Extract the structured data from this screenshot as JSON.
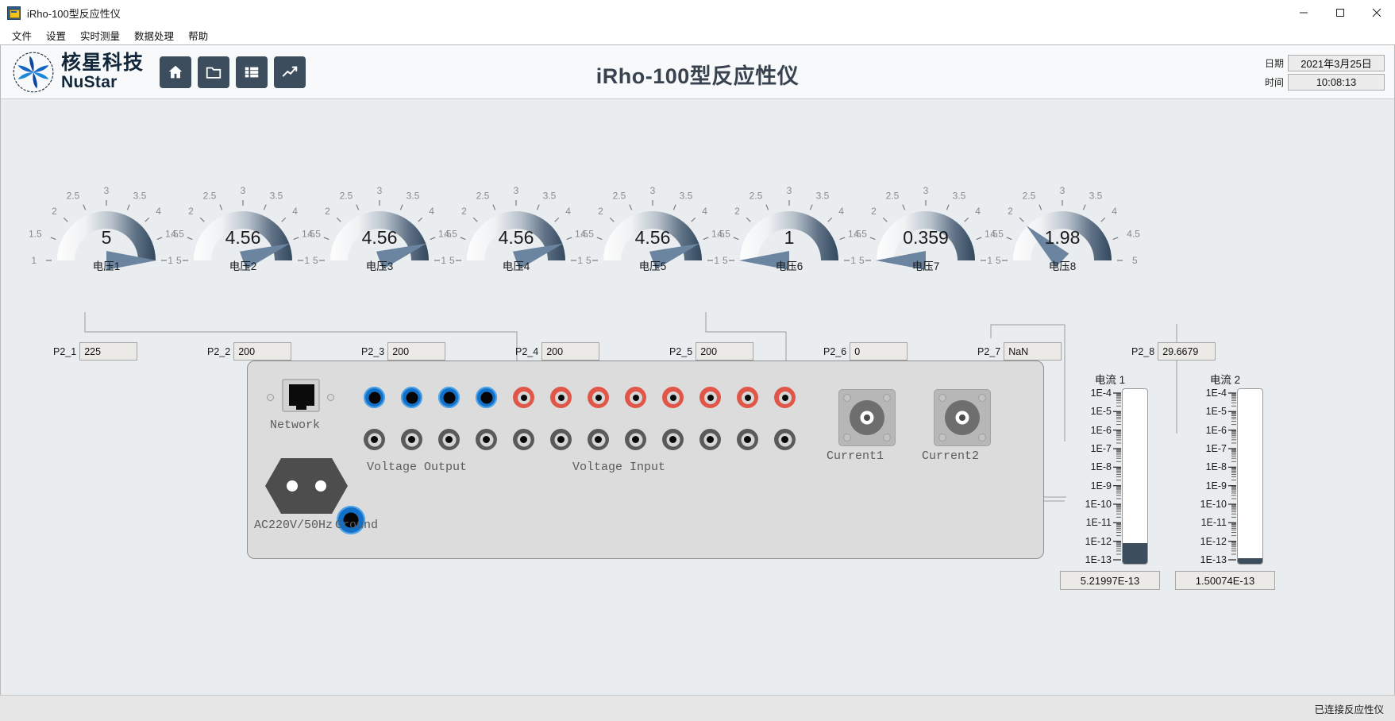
{
  "window": {
    "title": "iRho-100型反应性仪",
    "icon": "app-icon",
    "controls": {
      "minimize": "—",
      "maximize": "□",
      "close": "✕"
    }
  },
  "menubar": {
    "items": [
      {
        "label": "文件"
      },
      {
        "label": "设置"
      },
      {
        "label": "实时测量"
      },
      {
        "label": "数据处理"
      },
      {
        "label": "帮助"
      }
    ]
  },
  "header": {
    "logo": {
      "cn": "核星科技",
      "en": "NuStar",
      "icon": "nustar-logo-icon"
    },
    "title": "iRho-100型反应性仪",
    "toolbar": [
      {
        "name": "home",
        "icon": "home-icon"
      },
      {
        "name": "open-folder",
        "icon": "folder-icon"
      },
      {
        "name": "data-table",
        "icon": "list-icon"
      },
      {
        "name": "chart",
        "icon": "chart-line-icon"
      }
    ],
    "datetime": {
      "date_label": "日期",
      "date_value": "2021年3月25日",
      "time_label": "时间",
      "time_value": "10:08:13"
    }
  },
  "gauges": {
    "scale_ticks": [
      "1",
      "1.5",
      "2",
      "2.5",
      "3",
      "3.5",
      "4",
      "4.5",
      "5"
    ],
    "min": 1,
    "max": 5,
    "items": [
      {
        "label": "电压1",
        "value": "5",
        "numeric": 5.0
      },
      {
        "label": "电压2",
        "value": "4.56",
        "numeric": 4.56
      },
      {
        "label": "电压3",
        "value": "4.56",
        "numeric": 4.56
      },
      {
        "label": "电压4",
        "value": "4.56",
        "numeric": 4.56
      },
      {
        "label": "电压5",
        "value": "4.56",
        "numeric": 4.56
      },
      {
        "label": "电压6",
        "value": "1",
        "numeric": 1.0
      },
      {
        "label": "电压7",
        "value": "0.359",
        "numeric": 1.0
      },
      {
        "label": "电压8",
        "value": "1.98",
        "numeric": 1.98
      }
    ]
  },
  "p2_fields": [
    {
      "label": "P2_1",
      "value": "225"
    },
    {
      "label": "P2_2",
      "value": "200"
    },
    {
      "label": "P2_3",
      "value": "200"
    },
    {
      "label": "P2_4",
      "value": "200"
    },
    {
      "label": "P2_5",
      "value": "200"
    },
    {
      "label": "P2_6",
      "value": "0"
    },
    {
      "label": "P2_7",
      "value": "NaN"
    },
    {
      "label": "P2_8",
      "value": "29.6679"
    }
  ],
  "panel": {
    "labels": {
      "network": "Network",
      "ac_power": "AC220V/50Hz",
      "ground": "Ground",
      "voltage_output": "Voltage Output",
      "voltage_input": "Voltage Input",
      "current1": "Current1",
      "current2": "Current2"
    },
    "voltage_output_blue_jacks": 4,
    "voltage_output_red_jacks": 8,
    "voltage_input_gray_jacks": 12
  },
  "meters": [
    {
      "title": "电流 1",
      "value": "5.21997E-13",
      "tick_labels": [
        "1E-4",
        "1E-5",
        "1E-6",
        "1E-7",
        "1E-8",
        "1E-9",
        "1E-10",
        "1E-11",
        "1E-12",
        "1E-13"
      ],
      "fill_percent": 12
    },
    {
      "title": "电流 2",
      "value": "1.50074E-13",
      "tick_labels": [
        "1E-4",
        "1E-5",
        "1E-6",
        "1E-7",
        "1E-8",
        "1E-9",
        "1E-10",
        "1E-11",
        "1E-12",
        "1E-13"
      ],
      "fill_percent": 3
    }
  ],
  "statusbar": {
    "text": "已连接反应性仪"
  },
  "colors": {
    "accent_dark": "#3c4d5e",
    "jack_blue": "#1270c9",
    "jack_red": "#e0574a",
    "panel_bg": "#dcdcdc",
    "body_bg": "#e9edf0"
  }
}
